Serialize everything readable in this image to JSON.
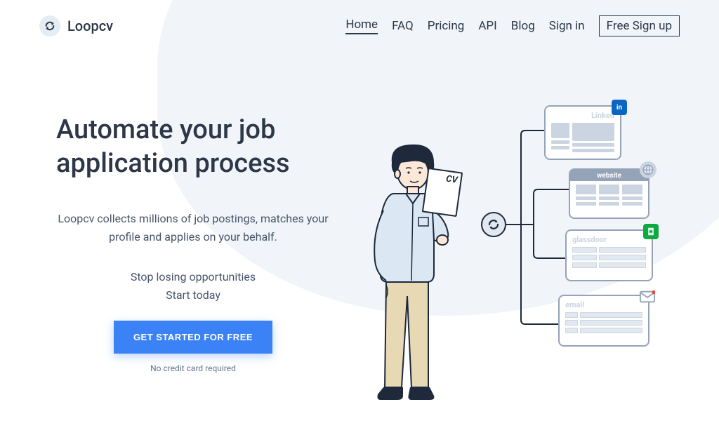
{
  "brand": {
    "name": "Loopcv"
  },
  "nav": {
    "home": "Home",
    "faq": "FAQ",
    "pricing": "Pricing",
    "api": "API",
    "blog": "Blog",
    "signin": "Sign in",
    "signup": "Free Sign up"
  },
  "hero": {
    "title": "Automate your job application process",
    "description": "Loopcv collects millions of job postings, matches your profile and applies on your behalf.",
    "sub_line1": "Stop losing opportunities",
    "sub_line2": "Start today",
    "cta_label": "GET STARTED FOR FREE",
    "cta_note": "No credit card required"
  },
  "illustration": {
    "cv_label": "CV",
    "cards": {
      "linkedin": {
        "label": "Linked",
        "badge": "in"
      },
      "website": {
        "label": "website"
      },
      "glassdoor": {
        "label": "glassdoor",
        "badge": "⧉"
      },
      "email": {
        "label": "email"
      }
    }
  }
}
